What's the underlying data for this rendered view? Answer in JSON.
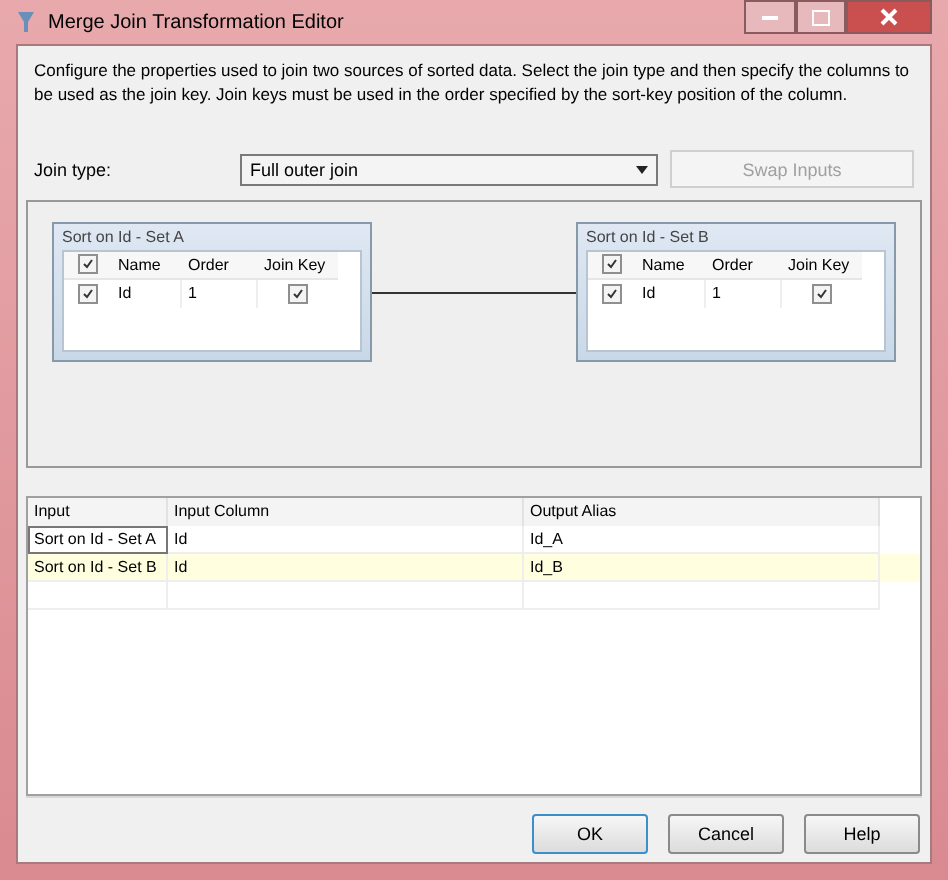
{
  "window": {
    "title": "Merge Join Transformation Editor"
  },
  "description": "Configure the properties used to join two sources of sorted data. Select the join type and then specify the columns to be used as the join key. Join keys must be used in the order specified by the sort-key position of the column.",
  "join_type": {
    "label": "Join type:",
    "value": "Full outer join"
  },
  "swap_button": {
    "label": "Swap Inputs",
    "disabled": true
  },
  "inputs": [
    {
      "title": "Sort on Id - Set A",
      "all_checked": true,
      "columns": [
        "Name",
        "Order",
        "Join Key"
      ],
      "rows": [
        {
          "checked": true,
          "name": "Id",
          "order": "1",
          "join_key": true
        }
      ]
    },
    {
      "title": "Sort on Id - Set B",
      "all_checked": true,
      "columns": [
        "Name",
        "Order",
        "Join Key"
      ],
      "rows": [
        {
          "checked": true,
          "name": "Id",
          "order": "1",
          "join_key": true
        }
      ]
    }
  ],
  "output": {
    "columns": [
      "Input",
      "Input Column",
      "Output Alias"
    ],
    "rows": [
      {
        "selected": false,
        "focused": true,
        "cells": [
          "Sort on Id - Set A",
          "Id",
          "Id_A"
        ]
      },
      {
        "selected": true,
        "focused": false,
        "cells": [
          "Sort on Id - Set B",
          "Id",
          "Id_B"
        ]
      }
    ]
  },
  "buttons": [
    {
      "label": "OK",
      "default": true
    },
    {
      "label": "Cancel",
      "default": false
    },
    {
      "label": "Help",
      "default": false
    }
  ]
}
